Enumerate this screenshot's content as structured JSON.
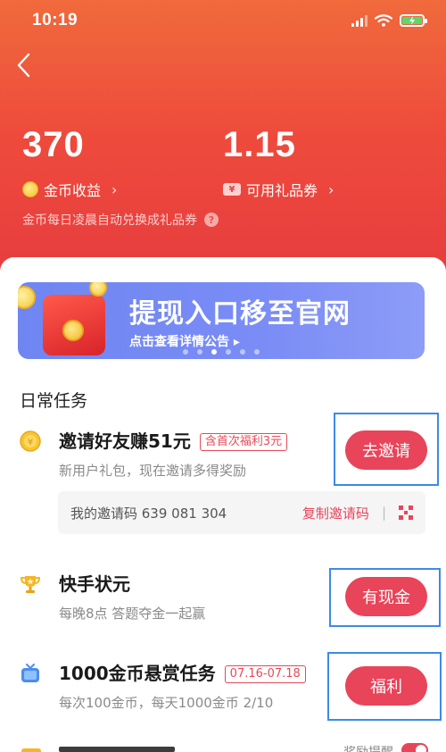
{
  "status_bar": {
    "time": "10:19"
  },
  "stats": {
    "coins_value": "370",
    "coins_label": "金币收益",
    "gift_value": "1.15",
    "gift_label": "可用礼品券",
    "note": "金币每日凌晨自动兑换成礼品券"
  },
  "banner": {
    "title": "提现入口移至官网",
    "subtitle": "点击查看详情公告 ▸",
    "dots_count": 6,
    "active_dot": 2
  },
  "daily_tasks": {
    "title": "日常任务",
    "items": [
      {
        "icon": "coin-icon",
        "title": "邀请好友赚51元",
        "tag": "含首次福利3元",
        "subtitle": "新用户礼包，现在邀请多得奖励",
        "button": "去邀请"
      },
      {
        "icon": "trophy-icon",
        "title": "快手状元",
        "tag": "",
        "subtitle": "每晚8点 答题夺金一起赢",
        "button": "有现金"
      },
      {
        "icon": "tv-icon",
        "title": "1000金币悬赏任务",
        "tag": "07.16-07.18",
        "subtitle": "每次100金币，每天1000金币 2/10",
        "button": "福利"
      }
    ]
  },
  "invite_code": {
    "label": "我的邀请码 639 081 304",
    "copy_label": "复制邀请码",
    "separator": "|"
  },
  "partial_row": {
    "reminder_label": "奖励提醒"
  },
  "colors": {
    "accent": "#e8445a",
    "header_top": "#f06a3c",
    "header_bottom": "#e63b3f",
    "banner": "#7a8cf6"
  }
}
